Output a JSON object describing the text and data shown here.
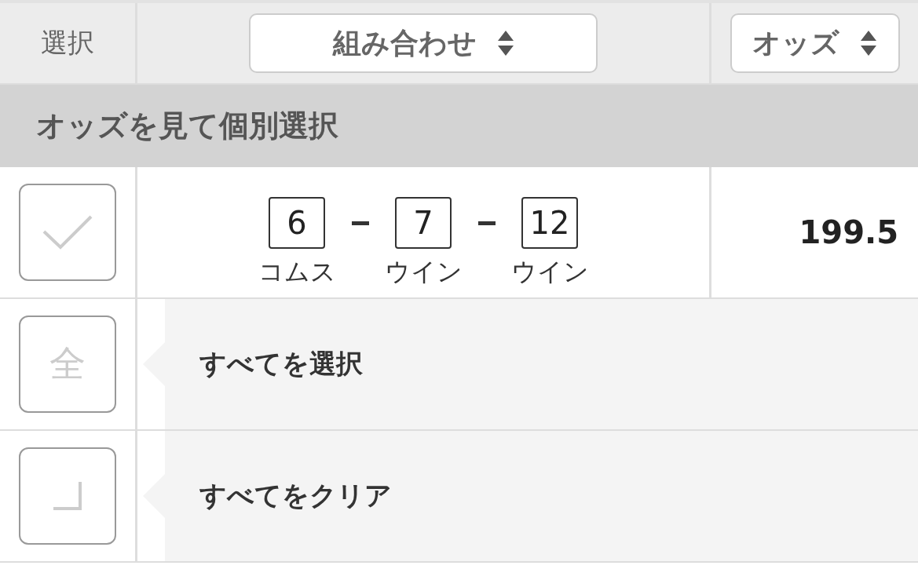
{
  "header": {
    "select_label": "選択",
    "columns": [
      {
        "label": "組み合わせ"
      },
      {
        "label": "オッズ"
      }
    ]
  },
  "section_title": "オッズを見て個別選択",
  "rows": [
    {
      "selected": false,
      "combination": [
        {
          "number": "6",
          "name": "コムス"
        },
        {
          "number": "7",
          "name": "ウイン"
        },
        {
          "number": "12",
          "name": "ウイン"
        }
      ],
      "odds": "199.5"
    }
  ],
  "actions": [
    {
      "kind": "select_all",
      "icon_text": "全",
      "label": "すべてを選択"
    },
    {
      "kind": "clear_all",
      "label": "すべてをクリア"
    }
  ]
}
